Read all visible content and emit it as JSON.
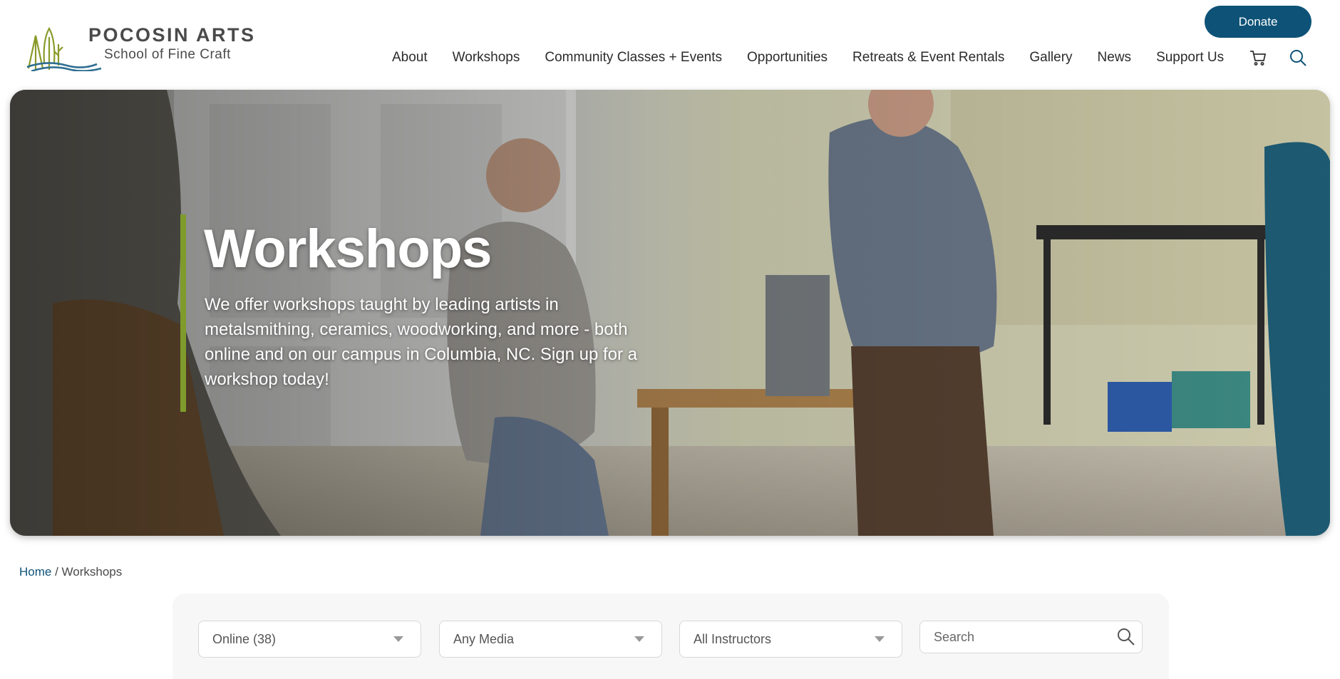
{
  "brand": {
    "name": "POCOSIN ARTS",
    "tagline": "School of Fine Craft",
    "colors": {
      "primary": "#0e5377",
      "accent_green": "#7f9b2c",
      "logo_wave": "#2f6f92",
      "logo_tree": "#8a9a2a"
    }
  },
  "header": {
    "donate_label": "Donate",
    "nav": [
      {
        "label": "About"
      },
      {
        "label": "Workshops"
      },
      {
        "label": "Community Classes + Events"
      },
      {
        "label": "Opportunities"
      },
      {
        "label": "Retreats & Event Rentals"
      },
      {
        "label": "Gallery"
      },
      {
        "label": "News"
      },
      {
        "label": "Support Us"
      }
    ],
    "icons": {
      "cart": "cart-icon",
      "search": "search-icon"
    }
  },
  "hero": {
    "title": "Workshops",
    "description": "We offer workshops taught by leading artists in metalsmithing, ceramics, woodworking, and more - both online and on our campus in Columbia, NC. Sign up for a workshop today!"
  },
  "breadcrumb": {
    "home": "Home",
    "separator": " / ",
    "current": "Workshops"
  },
  "filters": {
    "location": "Online (38)",
    "media": "Any Media",
    "instructor": "All Instructors",
    "search_placeholder": "Search"
  }
}
